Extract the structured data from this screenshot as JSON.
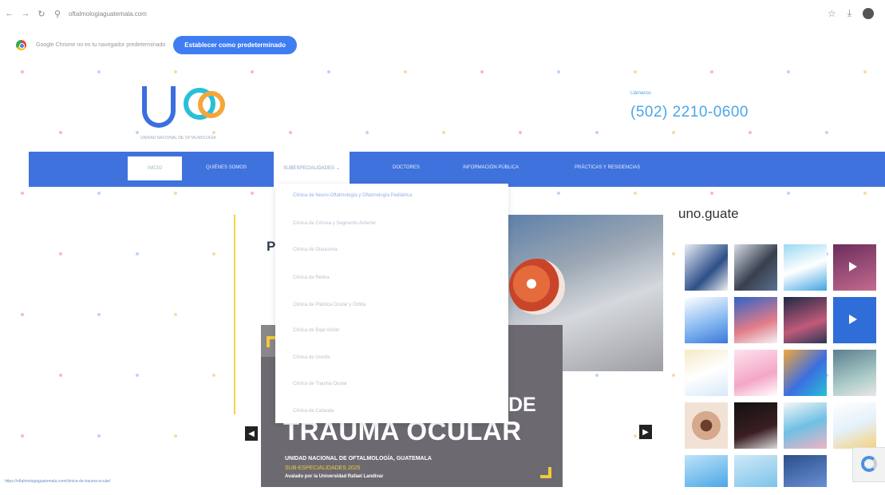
{
  "browser": {
    "url": "oftalmologiaguatemala.com",
    "infobar_text": "Google Chrome no es tu navegador predeterminado",
    "set_default_button": "Establecer como predeterminado"
  },
  "header": {
    "logo_tagline": "UNIDAD NACIONAL DE OFTALMOLOGÍA",
    "phone_label": "Llámanos",
    "phone_number": "(502) 2210-0600"
  },
  "nav": {
    "home_label": "INICIO",
    "items": [
      {
        "label": "QUIÉNES SOMOS"
      },
      {
        "label": "SUBESPECIALIDADES"
      },
      {
        "label": "DOCTORES"
      },
      {
        "label": "INFORMACIÓN PÚBLICA"
      },
      {
        "label": "PRÁCTICAS Y RESIDENCIAS"
      }
    ]
  },
  "dropdown": {
    "items": [
      {
        "label": "Clínica de Neuro-Oftalmología y Oftalmología Pediátrica"
      },
      {
        "label": "Clínica de Córnea y Segmento Anterior"
      },
      {
        "label": "Clínica de Glaucoma"
      },
      {
        "label": "Clínica de Retina"
      },
      {
        "label": "Clínica de Plástica Ocular y Órbita"
      },
      {
        "label": "Clínica de Baja Visión"
      },
      {
        "label": "Clínica de Uveítis"
      },
      {
        "label": "Clínica de Trauma Ocular"
      },
      {
        "label": "Clínica de Catarata"
      }
    ]
  },
  "slider": {
    "letter_p": "P",
    "word_de": "DE",
    "title": "TRAUMA OCULAR",
    "line1": "UNIDAD NACIONAL DE OFTALMOLOGÍA, GUATEMALA",
    "line2": "SUB-ESPECIALIDADES 2025",
    "line3": "Avalado por la Universidad Rafael Landívar",
    "prev_icon": "chevron-left-icon",
    "next_icon": "chevron-right-icon"
  },
  "instagram": {
    "handle": "uno.guate"
  },
  "status_bar": {
    "url": "https://oftalmologiaguatemala.com/clinica-de-trauma-ocular/"
  },
  "colors": {
    "nav_blue": "#3f72dc",
    "accent_blue": "#4aa7e6",
    "accent_yellow": "#f1c93a",
    "logo_blue": "#3b6fe0",
    "logo_cyan": "#28c0d8",
    "logo_orange": "#f5a63a"
  }
}
